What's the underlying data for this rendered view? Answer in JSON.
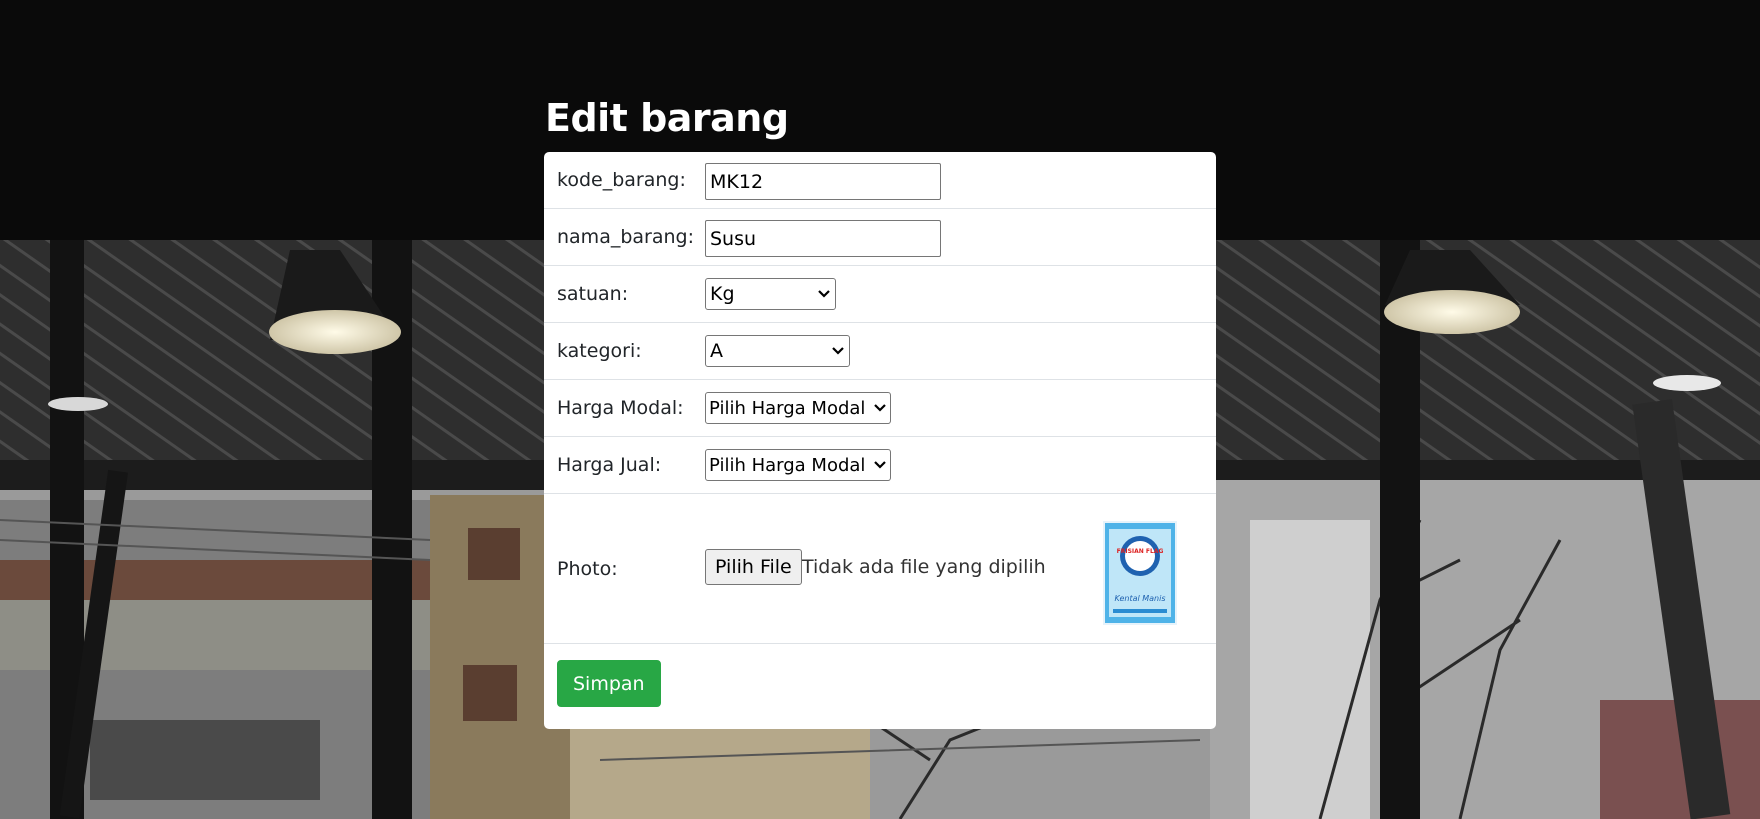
{
  "page": {
    "title": "Edit barang"
  },
  "form": {
    "kode_barang": {
      "label": "kode_barang:",
      "value": "MK12"
    },
    "nama_barang": {
      "label": "nama_barang:",
      "value": "Susu"
    },
    "satuan": {
      "label": "satuan:",
      "selected": "Kg"
    },
    "kategori": {
      "label": "kategori:",
      "selected": "A"
    },
    "harga_modal": {
      "label": "Harga Modal:",
      "selected": "Pilih Harga Modal"
    },
    "harga_jual": {
      "label": "Harga Jual:",
      "selected": "Pilih Harga Modal"
    },
    "photo": {
      "label": "Photo:",
      "button_label": "Pilih File",
      "status": "Tidak ada file yang dipilih",
      "thumbnail_icon": "milk-product-image",
      "thumbnail_text_brand": "FRISIAN FLAG",
      "thumbnail_text_product": "Kental Manis"
    },
    "submit_label": "Simpan"
  },
  "colors": {
    "submit_bg": "#28a745",
    "card_bg": "#ffffff",
    "row_divider": "#dee2e6"
  }
}
